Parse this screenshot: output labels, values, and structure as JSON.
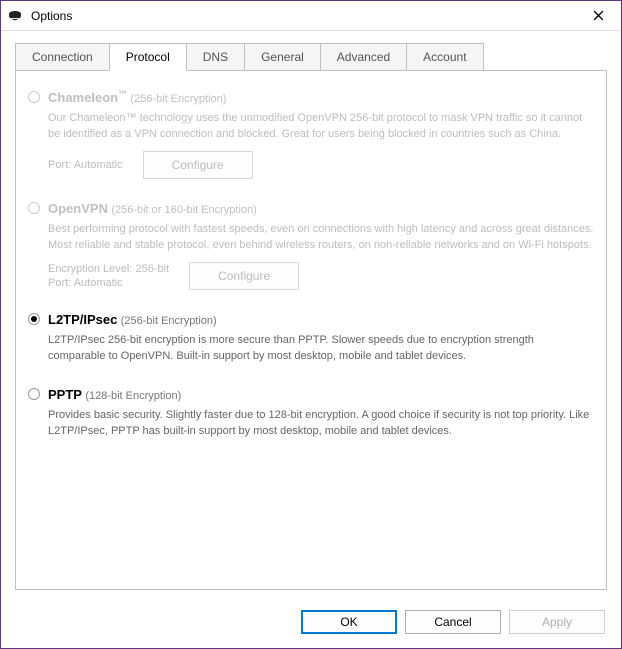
{
  "window": {
    "title": "Options"
  },
  "tabs": {
    "connection": "Connection",
    "protocol": "Protocol",
    "dns": "DNS",
    "general": "General",
    "advanced": "Advanced",
    "account": "Account"
  },
  "protocols": {
    "chameleon": {
      "name": "Chameleon",
      "tm": "™",
      "sub": "(256-bit Encryption)",
      "desc": "Our Chameleon™ technology uses the unmodified OpenVPN 256-bit protocol to mask VPN traffic so it cannot be identified as a VPN connection and blocked. Great for users being blocked in countries such as China.",
      "port_label": "Port:",
      "port_value": "Automatic",
      "configure": "Configure"
    },
    "openvpn": {
      "name": "OpenVPN",
      "sub": "(256-bit or 160-bit Encryption)",
      "desc": "Best performing protocol with fastest speeds, even on connections with high latency and across great distances. Most reliable and stable protocol, even behind wireless routers, on non-reliable networks and on Wi-Fi hotspots.",
      "enc_label": "Encryption Level:",
      "enc_value": "256-bit",
      "port_label": "Port:",
      "port_value": "Automatic",
      "configure": "Configure"
    },
    "l2tp": {
      "name": "L2TP/IPsec",
      "sub": "(256-bit Encryption)",
      "desc": "L2TP/IPsec 256-bit encryption is more secure than PPTP. Slower speeds due to encryption strength comparable to OpenVPN. Built-in support by most desktop, mobile and tablet devices."
    },
    "pptp": {
      "name": "PPTP",
      "sub": "(128-bit Encryption)",
      "desc": "Provides basic security. Slightly faster due to 128-bit encryption. A good choice if security is not top priority. Like L2TP/IPsec, PPTP has built-in support by most desktop, mobile and tablet devices."
    }
  },
  "footer": {
    "ok": "OK",
    "cancel": "Cancel",
    "apply": "Apply"
  }
}
